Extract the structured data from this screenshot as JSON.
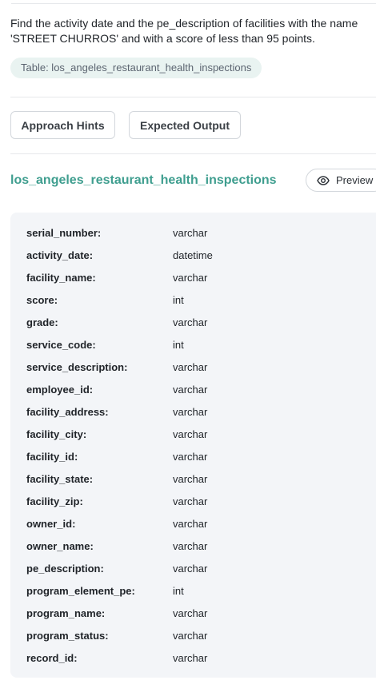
{
  "question": {
    "text": "Find the activity date and the pe_description of facilities with the name 'STREET CHURROS' and with a score of less than 95 points."
  },
  "table_pill": {
    "label": "Table: los_angeles_restaurant_health_inspections"
  },
  "buttons": {
    "approach_hints": "Approach Hints",
    "expected_output": "Expected Output",
    "preview": "Preview"
  },
  "schema": {
    "table_name": "los_angeles_restaurant_health_inspections",
    "columns": [
      {
        "name": "serial_number:",
        "type": "varchar"
      },
      {
        "name": "activity_date:",
        "type": "datetime"
      },
      {
        "name": "facility_name:",
        "type": "varchar"
      },
      {
        "name": "score:",
        "type": "int"
      },
      {
        "name": "grade:",
        "type": "varchar"
      },
      {
        "name": "service_code:",
        "type": "int"
      },
      {
        "name": "service_description:",
        "type": "varchar"
      },
      {
        "name": "employee_id:",
        "type": "varchar"
      },
      {
        "name": "facility_address:",
        "type": "varchar"
      },
      {
        "name": "facility_city:",
        "type": "varchar"
      },
      {
        "name": "facility_id:",
        "type": "varchar"
      },
      {
        "name": "facility_state:",
        "type": "varchar"
      },
      {
        "name": "facility_zip:",
        "type": "varchar"
      },
      {
        "name": "owner_id:",
        "type": "varchar"
      },
      {
        "name": "owner_name:",
        "type": "varchar"
      },
      {
        "name": "pe_description:",
        "type": "varchar"
      },
      {
        "name": "program_element_pe:",
        "type": "int"
      },
      {
        "name": "program_name:",
        "type": "varchar"
      },
      {
        "name": "program_status:",
        "type": "varchar"
      },
      {
        "name": "record_id:",
        "type": "varchar"
      }
    ]
  },
  "colors": {
    "accent": "#3f9e8f",
    "pill_bg": "#e9f3f1",
    "card_bg": "#f3f5f8"
  },
  "icons": {
    "preview": "eye-icon"
  }
}
